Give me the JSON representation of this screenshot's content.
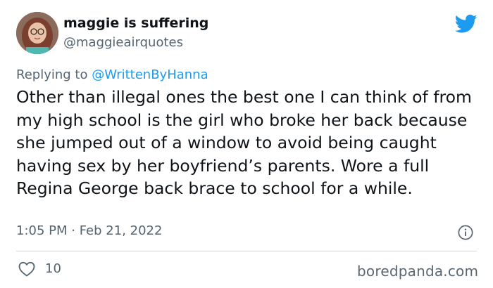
{
  "author": {
    "display_name": "maggie is suffering",
    "handle": "@maggieairquotes",
    "avatar_icon": "user-avatar-photo"
  },
  "reply": {
    "prefix": "Replying to ",
    "mention": "@WrittenByHanna"
  },
  "tweet": {
    "text": "Other than illegal ones the best one I can think of from my high school is the girl who broke her back because she jumped out of a window to avoid being caught having sex by her boyfriend’s parents. Wore a full Regina George back brace to school for a while.",
    "timestamp": "1:05 PM · Feb 21, 2022",
    "likes": "10"
  },
  "watermark": "boredpanda.com",
  "colors": {
    "brand": "#1d9bf0",
    "text": "#0f1419",
    "muted": "#536471"
  },
  "icons": {
    "platform": "twitter-bird-icon",
    "info": "info-icon",
    "like": "heart-icon"
  }
}
